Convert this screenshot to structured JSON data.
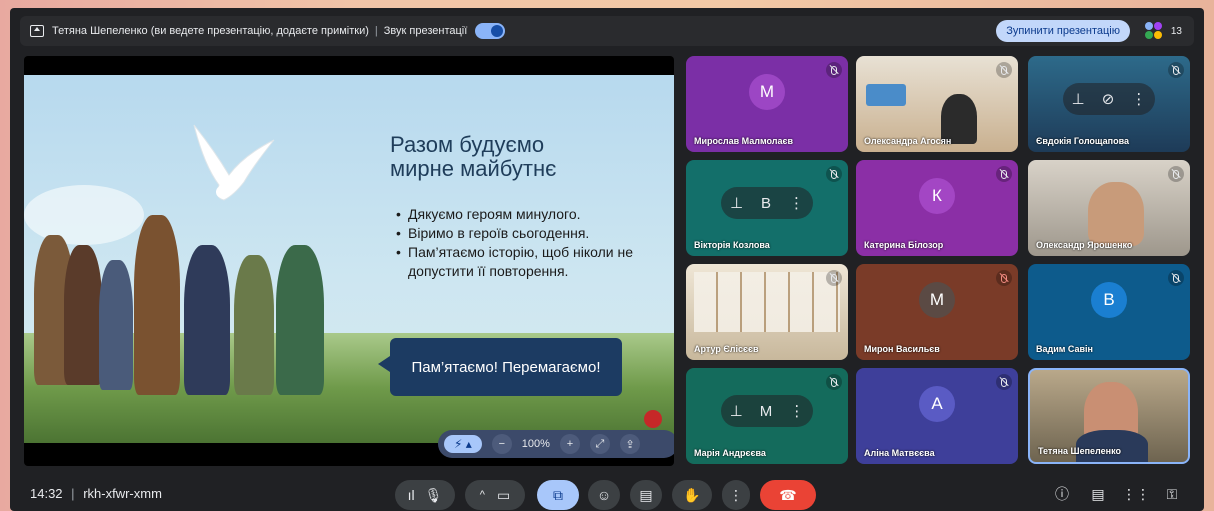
{
  "topbar": {
    "presenter_text": "Тетяна Шепеленко (ви ведете презентацію, додаєте примітки)",
    "sound_label": "Звук презентації",
    "stop_button": "Зупинити презентацію",
    "participant_count": "13"
  },
  "slide": {
    "title_line1": "Разом будуємо",
    "title_line2": "мирне майбутнє",
    "bullets": [
      "Дякуємо героям минулого.",
      "Віримо в героїв сьогодення.",
      "Пам’ятаємо історію, щоб ніколи не допустити її повторення."
    ],
    "bubble": "Пам’ятаємо! Перемагаємо!",
    "zoom": "100%"
  },
  "tiles": [
    {
      "name": "Мирослав Малмолаєв",
      "initial": "M",
      "color": "#7b2fa6"
    },
    {
      "name": "Олександра Агосян",
      "color": "#c9b08f"
    },
    {
      "name": "Євдокія Голощапова",
      "color": "#1e3b58"
    },
    {
      "name": "Вікторія Козлова",
      "initial": "В",
      "color": "#136f6a"
    },
    {
      "name": "Катерина Білозор",
      "initial": "К",
      "color": "#8b2fa6"
    },
    {
      "name": "Олександр Ярошенко",
      "color": "#b7b1a8"
    },
    {
      "name": "Артур Єлісєєв",
      "color": "#d9cfc0"
    },
    {
      "name": "Мирон Васильєв",
      "initial": "М",
      "color": "#7a3b28"
    },
    {
      "name": "Вадим Савін",
      "initial": "В",
      "color": "#0d5b8c"
    },
    {
      "name": "Марія Андрєєва",
      "initial": "М",
      "color": "#146b5c"
    },
    {
      "name": "Аліна Матвєєва",
      "initial": "А",
      "color": "#3e3f9a"
    },
    {
      "name": "Тетяна Шепеленко",
      "color": "#8a7a5e"
    }
  ],
  "bottombar": {
    "time": "14:32",
    "meeting_code": "rkh-xfwr-xmm"
  }
}
